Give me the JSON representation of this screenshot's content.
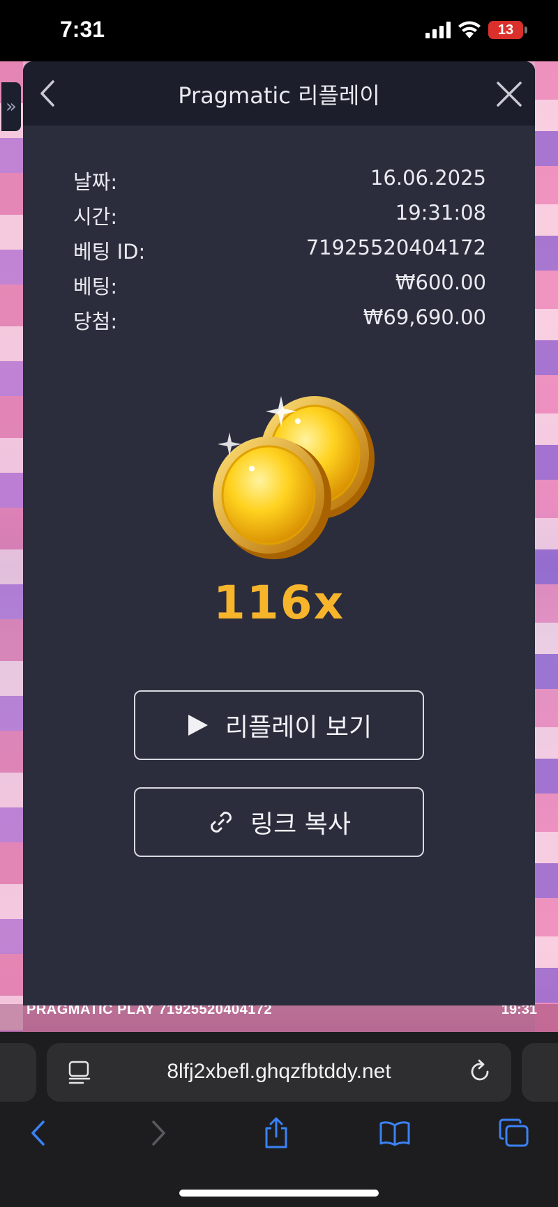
{
  "status_bar": {
    "time": "7:31",
    "battery": "13"
  },
  "game": {
    "footer_left": "PRAGMATIC PLAY  71925520404172",
    "footer_right": "19:31"
  },
  "modal": {
    "title": "Pragmatic 리플레이",
    "info": [
      {
        "label": "날짜:",
        "value": "16.06.2025"
      },
      {
        "label": "시간:",
        "value": "19:31:08"
      },
      {
        "label": "베팅 ID:",
        "value": "71925520404172"
      },
      {
        "label": "베팅:",
        "value": "₩600.00"
      },
      {
        "label": "당첨:",
        "value": "₩69,690.00"
      }
    ],
    "multiplier": "116x",
    "replay_button": "리플레이 보기",
    "copy_button": "링크 복사"
  },
  "browser": {
    "url": "8lfj2xbefl.ghqzfbtddy.net"
  },
  "colors": {
    "modal_bg": "#2b2d3c",
    "header_bg": "#1c1e2b",
    "multiplier": "#f7b52c",
    "safari_blue": "#3b82f6"
  }
}
